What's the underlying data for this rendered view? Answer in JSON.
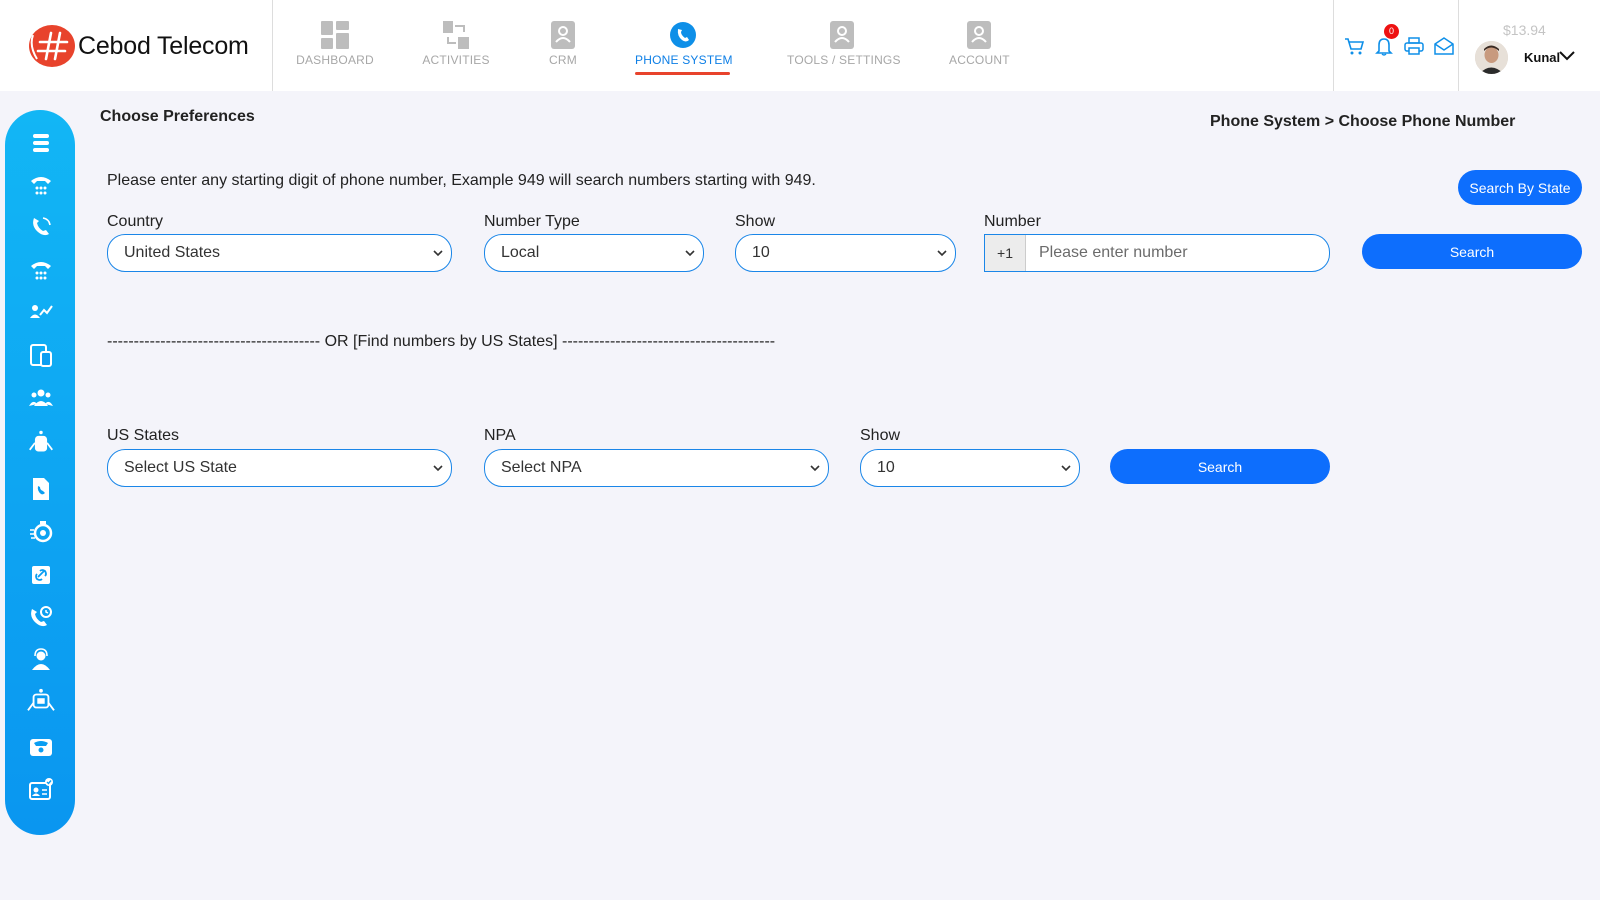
{
  "brand": {
    "name": "Cebod Telecom"
  },
  "nav": {
    "items": [
      {
        "label": "DASHBOARD",
        "icon": "dashboard-icon"
      },
      {
        "label": "ACTIVITIES",
        "icon": "activities-icon"
      },
      {
        "label": "CRM",
        "icon": "crm-icon"
      },
      {
        "label": "PHONE SYSTEM",
        "icon": "phone-system-icon",
        "active": true
      },
      {
        "label": "TOOLS / SETTINGS",
        "icon": "tools-icon"
      },
      {
        "label": "ACCOUNT",
        "icon": "account-icon"
      }
    ]
  },
  "header": {
    "notification_count": "0",
    "balance": "$13.94",
    "username": "Kunal",
    "icons": [
      "cart-icon",
      "bell-icon",
      "printer-icon",
      "mail-icon"
    ]
  },
  "sidebar": {
    "icons": [
      "menu-icon",
      "desk-phone-icon",
      "phone-call-icon",
      "desk-phone-icon",
      "team-chart-icon",
      "devices-icon",
      "users-icon",
      "robot-icon",
      "phone-file-icon",
      "timer-icon",
      "link-icon",
      "phone-settings-icon",
      "agent-icon",
      "bot-icon",
      "telephone-icon",
      "id-card-icon"
    ]
  },
  "page": {
    "title": "Choose Preferences",
    "breadcrumb": "Phone System > Choose Phone Number",
    "instruction": "Please enter any starting digit of phone number, Example 949 will search numbers starting with 949.",
    "search_by_state_label": "Search By State"
  },
  "number_search": {
    "country_label": "Country",
    "country_value": "United States",
    "type_label": "Number Type",
    "type_value": "Local",
    "show_label": "Show",
    "show_value": "10",
    "number_label": "Number",
    "prefix": "+1",
    "number_placeholder": "Please enter number",
    "search_label": "Search"
  },
  "divider_text": "---------------------------------------- OR [Find numbers by US States] ----------------------------------------",
  "state_search": {
    "state_label": "US States",
    "state_value": "Select US State",
    "npa_label": "NPA",
    "npa_value": "Select NPA",
    "show_label": "Show",
    "show_value": "10",
    "search_label": "Search"
  },
  "colors": {
    "accent": "#0d6efd",
    "active_nav": "#0e7fe6",
    "underline": "#e8432c",
    "sidebar_top": "#12b6f5",
    "sidebar_bottom": "#0a96f0"
  }
}
